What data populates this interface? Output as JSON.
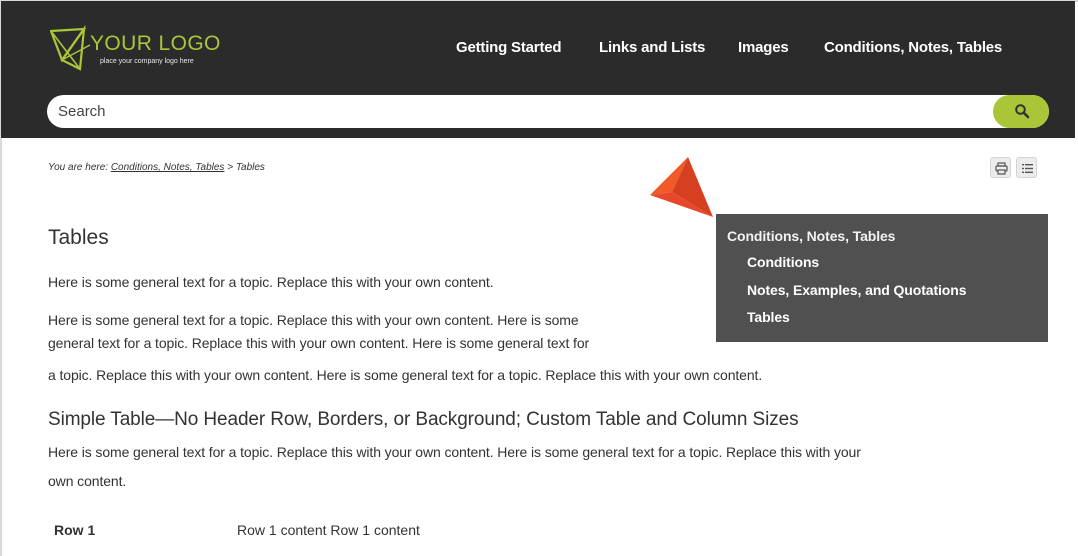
{
  "header": {
    "logo": {
      "title": "YOUR LOGO",
      "subtitle": "place your company logo here",
      "icon": "paper-plane-logo-icon"
    },
    "nav": [
      {
        "label": "Getting Started"
      },
      {
        "label": "Links and Lists"
      },
      {
        "label": "Images"
      },
      {
        "label": "Conditions, Notes, Tables"
      }
    ],
    "search": {
      "placeholder": "Search",
      "icon": "search-icon"
    }
  },
  "breadcrumb": {
    "prefix": "You are here: ",
    "link": "Conditions, Notes, Tables",
    "separator": " > ",
    "current": "Tables"
  },
  "toolbar": {
    "print_icon": "print-icon",
    "toc_icon": "list-icon"
  },
  "minitoc": {
    "items": [
      {
        "label": "Conditions, Notes, Tables"
      },
      {
        "label": "Conditions"
      },
      {
        "label": "Notes, Examples, and Quotations"
      },
      {
        "label": "Tables"
      }
    ]
  },
  "content": {
    "title": "Tables",
    "para1": "Here is some general text for a topic. Replace this with your own content.",
    "para2_lines": [
      "Here is some general text for a topic. Replace this with your own content. Here is some",
      "general text for a topic. Replace this with your own content. Here is some general text for",
      "a topic. Replace this with your own content. Here is some general text for a topic. Replace this with your own content."
    ],
    "subheading": "Simple Table—No Header Row, Borders, or Background; Custom Table and Column Sizes",
    "para3_lines": [
      "Here is some general text for a topic. Replace this with your own content. Here is some general text for a topic. Replace this with your",
      "own content."
    ],
    "table": {
      "rows": [
        {
          "label": "Row 1",
          "content": "Row 1 content Row 1 content"
        }
      ]
    }
  },
  "colors": {
    "header_bg": "#2b2b2b",
    "accent": "#a9c638",
    "minitoc_bg": "#505050",
    "callout_arrow": "#e8472b"
  }
}
